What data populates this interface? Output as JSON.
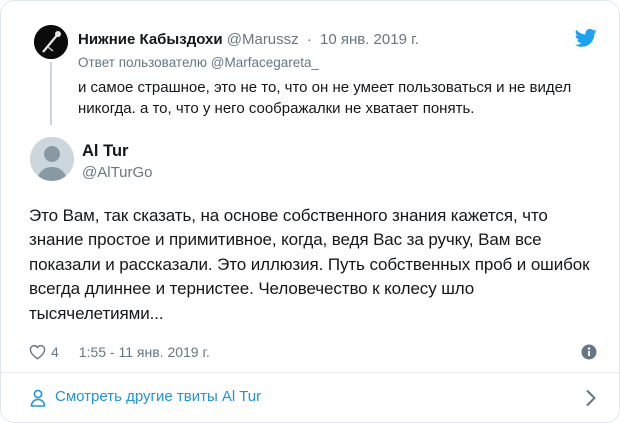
{
  "parent_tweet": {
    "author_name": "Нижние Кабыздохи",
    "author_handle": "@Marussz",
    "separator": "·",
    "date": "10 янв. 2019 г.",
    "reply_to_prefix": "Ответ пользователю",
    "reply_to_handle": "@Marfacegareta_",
    "text": "и самое страшное, это не то, что он не умеет пользоваться и не видел никогда. а то, что у него соображалки не хватает понять."
  },
  "main_tweet": {
    "author_name": "Al Tur",
    "author_handle": "@AlTurGo",
    "text": "Это Вам, так сказать, на основе собственного знания кажется, что знание простое и примитивное, когда, ведя Вас за ручку, Вам все показали и рассказали. Это иллюзия. Путь собственных проб и ошибок всегда длиннее и тернистее. Человечество к колесу шло тысячелетиями...",
    "like_count": "4",
    "timestamp": "1:55 - 11 янв. 2019 г."
  },
  "footer": {
    "more_tweets_label": "Смотреть другие твиты Al Tur"
  },
  "icons": {
    "brand": "twitter-bird-icon",
    "like": "heart-icon",
    "info": "info-icon",
    "person": "person-icon",
    "chevron": "chevron-right-icon"
  },
  "colors": {
    "twitter_blue": "#1da1f2",
    "link_blue": "#1b95e0",
    "secondary_text": "#657786",
    "primary_text": "#14171a",
    "border": "#e1e8ed"
  }
}
